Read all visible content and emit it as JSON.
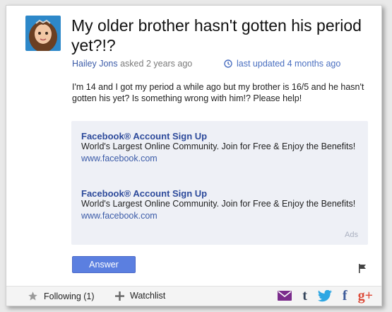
{
  "question": {
    "title": "My older brother hasn't gotten his period yet?!?",
    "author": "Hailey Jons",
    "asked": "asked 2 years ago",
    "updated": "last updated 4 months ago",
    "body": "I'm 14 and I got my period a while ago but my brother is 16/5 and he hasn't gotten his yet? Is something wrong with him!? Please help!"
  },
  "ads": {
    "items": [
      {
        "title": "Facebook® Account Sign Up",
        "text": "World's Largest Online Community. Join for Free & Enjoy the Benefits!",
        "url": "www.facebook.com"
      },
      {
        "title": "Facebook® Account Sign Up",
        "text": "World's Largest Online Community. Join for Free & Enjoy the Benefits!",
        "url": "www.facebook.com"
      }
    ],
    "label": "Ads"
  },
  "actions": {
    "answer": "Answer"
  },
  "footer": {
    "following": "Following (1)",
    "watchlist": "Watchlist",
    "social": {
      "tumblr": "t",
      "facebook": "f",
      "googleplus": "g+"
    }
  },
  "colors": {
    "link": "#3b5ba8",
    "button": "#5b7fe0",
    "tumblr": "#35465c",
    "twitter": "#2fa7e3",
    "facebook": "#3b5998",
    "googleplus": "#dd4b39",
    "mail": "#7b2b8c"
  },
  "icons": [
    "avatar-image",
    "clock-icon",
    "flag-icon",
    "star-icon",
    "plus-icon",
    "mail-icon",
    "tumblr-icon",
    "twitter-icon",
    "facebook-icon",
    "googleplus-icon"
  ]
}
